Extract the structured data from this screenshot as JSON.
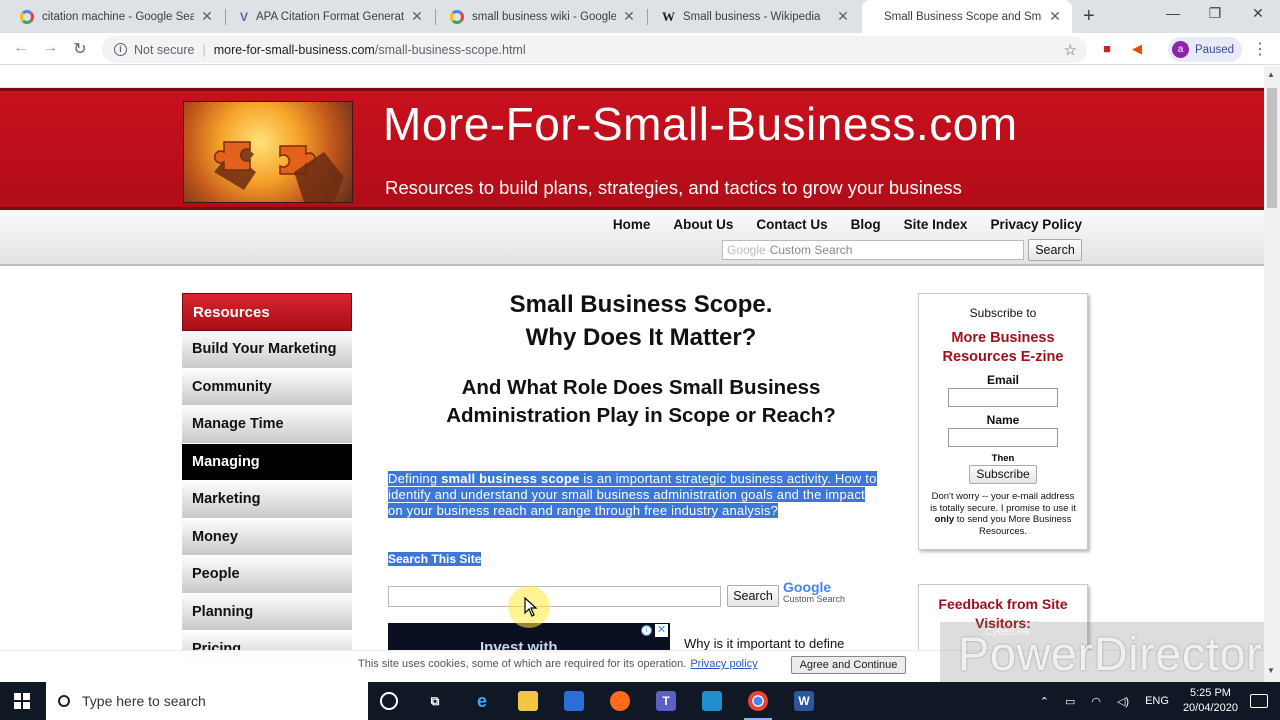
{
  "browser": {
    "tabs": [
      {
        "label": "citation machine - Google Sear",
        "favicon": "google-icon",
        "active": false
      },
      {
        "label": "APA Citation Format Generator",
        "favicon": "citation-icon",
        "active": false
      },
      {
        "label": "small business wiki - Google Se",
        "favicon": "google-icon",
        "active": false
      },
      {
        "label": "Small business - Wikipedia",
        "favicon": "wikipedia-icon",
        "active": false
      },
      {
        "label": "Small Business Scope and Sma",
        "favicon": "none",
        "active": true
      }
    ],
    "new_tab_glyph": "+",
    "not_secure": "Not secure",
    "url_host": "more-for-small-business.com",
    "url_path": "/small-business-scope.html",
    "profile_initial": "a",
    "profile_status": "Paused"
  },
  "site": {
    "title": "More-For-Small-Business.com",
    "tagline": "Resources to build plans, strategies, and tactics to grow your business",
    "nav": [
      "Home",
      "About Us",
      "Contact Us",
      "Blog",
      "Site Index",
      "Privacy Policy"
    ],
    "search_watermark": "Google",
    "search_placeholder": "Custom Search",
    "search_button": "Search"
  },
  "sidebar": {
    "header": "Resources",
    "items": [
      "Build Your Marketing",
      "Community",
      "Manage Time",
      "Managing",
      "Marketing",
      "Money",
      "People",
      "Planning",
      "Pricing"
    ],
    "active_item": "Managing"
  },
  "article": {
    "h1_line1": "Small Business Scope.",
    "h1_line2": "Why Does It Matter?",
    "h2_line1": "And What Role Does Small Business",
    "h2_line2": "Administration Play in Scope or Reach?",
    "intro_pre": "Defining ",
    "intro_bold": "small business scope",
    "intro_post": " is an important strategic business activity. How to identify and understand your small business administration goals and the impact on your business reach and range through free industry analysis?",
    "search_this_site": "Search This Site",
    "cse_button": "Search",
    "cse_logo": "Google",
    "cse_custom": "Custom Search",
    "ad_text": "Invest with",
    "why_text": "Why is it important to define"
  },
  "subscribe": {
    "subscribe_to": "Subscribe to",
    "zine_line1": "More Business",
    "zine_line2": "Resources E-zine",
    "email_label": "Email",
    "name_label": "Name",
    "then_label": "Then",
    "button": "Subscribe",
    "note_pre": "Don't worry -- your e-mail address is totally secure. I promise to use it ",
    "note_bold": "only",
    "note_post": " to send you More Business Resources."
  },
  "feedback": {
    "line1": "Feedback from Site",
    "line2": "Visitors:"
  },
  "cookie": {
    "text": "This site uses cookies, some of which are required for its operation.",
    "link": "Privacy policy",
    "button": "Agree and Continue"
  },
  "watermark": {
    "small": "CyberLink",
    "big": "PowerDirector"
  },
  "taskbar": {
    "search_placeholder": "Type here to search",
    "language": "ENG",
    "time": "5:25 PM",
    "date": "20/04/2020"
  }
}
